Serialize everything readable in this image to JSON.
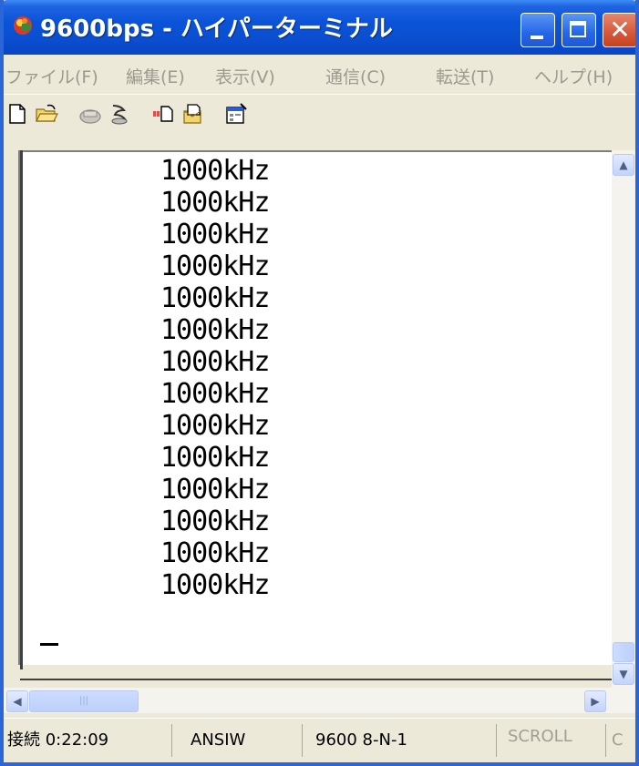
{
  "window": {
    "title": "9600bps - ハイパーターミナル"
  },
  "menu": {
    "items": [
      {
        "label": "ファイル(F)"
      },
      {
        "label": "編集(E)"
      },
      {
        "label": "表示(V)"
      },
      {
        "label": "通信(C)"
      },
      {
        "label": "転送(T)"
      },
      {
        "label": "ヘルプ(H)"
      }
    ]
  },
  "toolbar": {
    "icons": [
      "new-document-icon",
      "open-folder-icon",
      "connect-phone-icon",
      "disconnect-icon",
      "send-icon",
      "receive-icon",
      "properties-icon"
    ]
  },
  "terminal": {
    "lines": [
      "1000kHz",
      "1000kHz",
      "1000kHz",
      "1000kHz",
      "1000kHz",
      "1000kHz",
      "1000kHz",
      "1000kHz",
      "1000kHz",
      "1000kHz",
      "1000kHz",
      "1000kHz",
      "1000kHz",
      "1000kHz"
    ]
  },
  "statusbar": {
    "connection": "接続 0:22:09",
    "emulation": "ANSIW",
    "settings": "9600 8-N-1",
    "scroll": "SCROLL",
    "caps": "C"
  },
  "colors": {
    "titlebar": "#0b4fd0",
    "window_bg": "#ece9d8",
    "terminal_bg": "#ffffff"
  }
}
